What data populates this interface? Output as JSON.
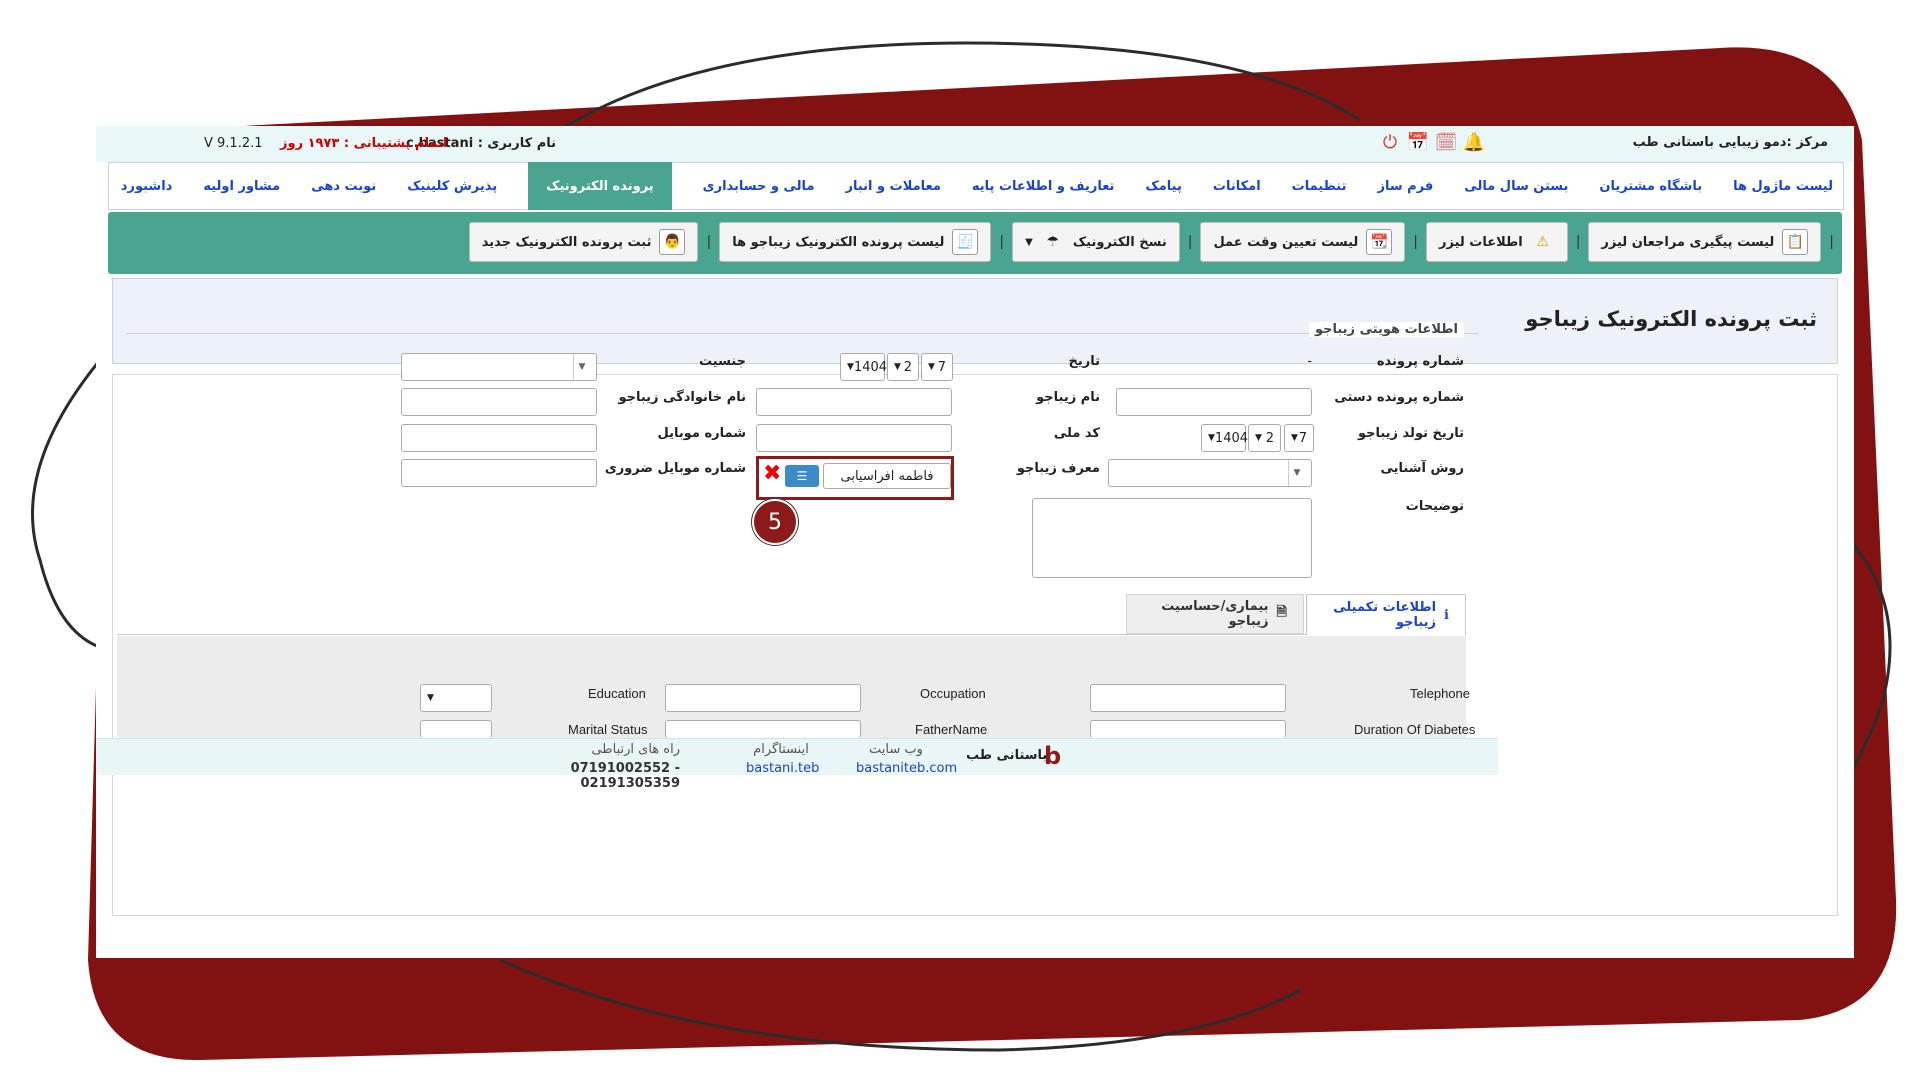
{
  "topbar": {
    "center_label": "مرکز :دمو زیبایی باستانی طب",
    "user_label": "نام کاربری : c.bastani",
    "support_label": "اتمام پشتیبانی : ۱۹۷۳ روز",
    "version": "V 9.1.2.1",
    "icons": [
      "bell-icon",
      "calendar-list-icon",
      "calendar-check-icon",
      "power-icon"
    ]
  },
  "menu": {
    "items": [
      "داشبورد",
      "مشاور اولیه",
      "نوبت دهی",
      "پذیرش کلینیک",
      "پرونده الکترونیک",
      "مالی و حسابداری",
      "معاملات و انبار",
      "تعاریف و اطلاعات پایه",
      "پیامک",
      "امکانات",
      "تنظیمات",
      "فرم ساز",
      "بستن سال مالی",
      "باشگاه مشتریان",
      "لیست ماژول ها"
    ],
    "active": "پرونده الکترونیک"
  },
  "subnav": {
    "new_record": "ثبت پرونده الکترونیک جدید",
    "record_list": "لیست پرونده الکترونیک زیباجو ها",
    "prescriptions": "نسخ الکترونیک",
    "appointments": "لیست تعیین وقت عمل",
    "laser_info": "اطلاعات لیزر",
    "laser_followup": "لیست پیگیری مراجعان لیزر"
  },
  "page": {
    "title": "ثبت پرونده الکترونیک زیباجو",
    "section_legend": "اطلاعات هویتی زیباجو"
  },
  "form": {
    "file_number_label": "شماره پرونده",
    "file_number_value": "-",
    "date_label": "تاریخ",
    "date_day": "7",
    "date_month": "2",
    "date_year": "1404",
    "gender_label": "جنسیت",
    "manual_file_label": "شماره پرونده دستی",
    "first_name_label": "نام زیباجو",
    "last_name_label": "نام خانوادگی زیباجو",
    "birth_label": "تاریخ تولد زیباجو",
    "birth_day": "7",
    "birth_month": "2",
    "birth_year": "1404",
    "national_id_label": "کد ملی",
    "mobile_label": "شماره موبایل",
    "acquaint_label": "روش آشنایی",
    "referrer_label": "معرف زیباجو",
    "referrer_value": "فاطمه افراسیابی",
    "emergency_label": "شماره موبایل ضروری",
    "notes_label": "توضیحات",
    "badge_number": "5"
  },
  "tabs": {
    "supplement": "اطلاعات تکمیلی زیباجو",
    "illness": "بیماری/حساسیت زیباجو"
  },
  "extra": {
    "telephone": "Telephone",
    "occupation": "Occupation",
    "education": "Education",
    "diabetes": "Duration Of Diabetes",
    "father": "FatherName",
    "marital": "Marital Status"
  },
  "footer": {
    "brand": "باستانی طب",
    "website_label": "وب سایت",
    "website_value": "bastaniteb.com",
    "instagram_label": "اینستاگرام",
    "instagram_value": "bastani.teb",
    "contact_label": "راه های ارتباطی",
    "contact_value": "07191002552 - 02191305359"
  },
  "colors": {
    "accent_green": "#4aa58e",
    "frame_red": "#8b1a1a",
    "link_blue": "#1b45c6"
  }
}
